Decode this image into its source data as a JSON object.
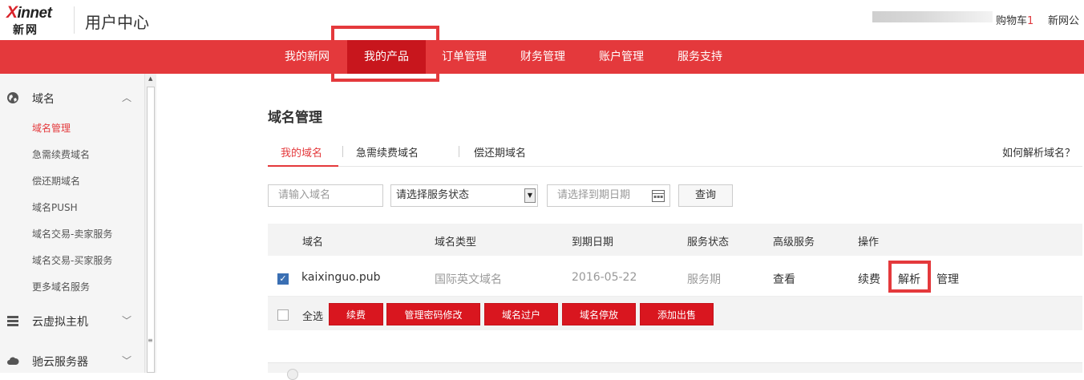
{
  "header": {
    "logo_top": "Xinnet",
    "logo_bottom": "新网",
    "title": "用户中心",
    "cart_label": "购物车",
    "cart_count": "1",
    "brand_link": "新网公"
  },
  "nav": {
    "items": [
      "我的新网",
      "我的产品",
      "订单管理",
      "财务管理",
      "账户管理",
      "服务支持"
    ],
    "active_index": 1
  },
  "sidebar": {
    "sections": [
      {
        "label": "域名",
        "icon": "globe-icon",
        "expanded": true
      },
      {
        "label": "云虚拟主机",
        "icon": "server-icon",
        "expanded": false
      },
      {
        "label": "驰云服务器",
        "icon": "cloud-icon",
        "expanded": false
      }
    ],
    "domain_items": [
      "域名管理",
      "急需续费域名",
      "偿还期域名",
      "域名PUSH",
      "域名交易-卖家服务",
      "域名交易-买家服务",
      "更多域名服务"
    ],
    "active_item": 0
  },
  "main": {
    "title": "域名管理",
    "tabs": [
      "我的域名",
      "急需续费域名",
      "偿还期域名"
    ],
    "help_link": "如何解析域名？",
    "filters": {
      "domain_placeholder": "请输入域名",
      "status_select": "请选择服务状态",
      "date_placeholder": "请选择到期日期",
      "query_button": "查询"
    },
    "table": {
      "headers": [
        "域名",
        "域名类型",
        "到期日期",
        "服务状态",
        "高级服务",
        "操作"
      ],
      "rows": [
        {
          "checked": true,
          "domain": "kaixinguo.pub",
          "type": "国际英文域名",
          "expiry": "2016-05-22",
          "status": "服务期",
          "advanced": "查看",
          "actions": [
            "续费",
            "解析",
            "管理"
          ]
        }
      ]
    },
    "bulk": {
      "select_all": "全选",
      "buttons": [
        "续费",
        "管理密码修改",
        "域名过户",
        "域名停放",
        "添加出售"
      ]
    }
  },
  "colors": {
    "brand_red": "#e4393c",
    "nav_active": "#c8161d",
    "button_red": "#d9161f"
  }
}
